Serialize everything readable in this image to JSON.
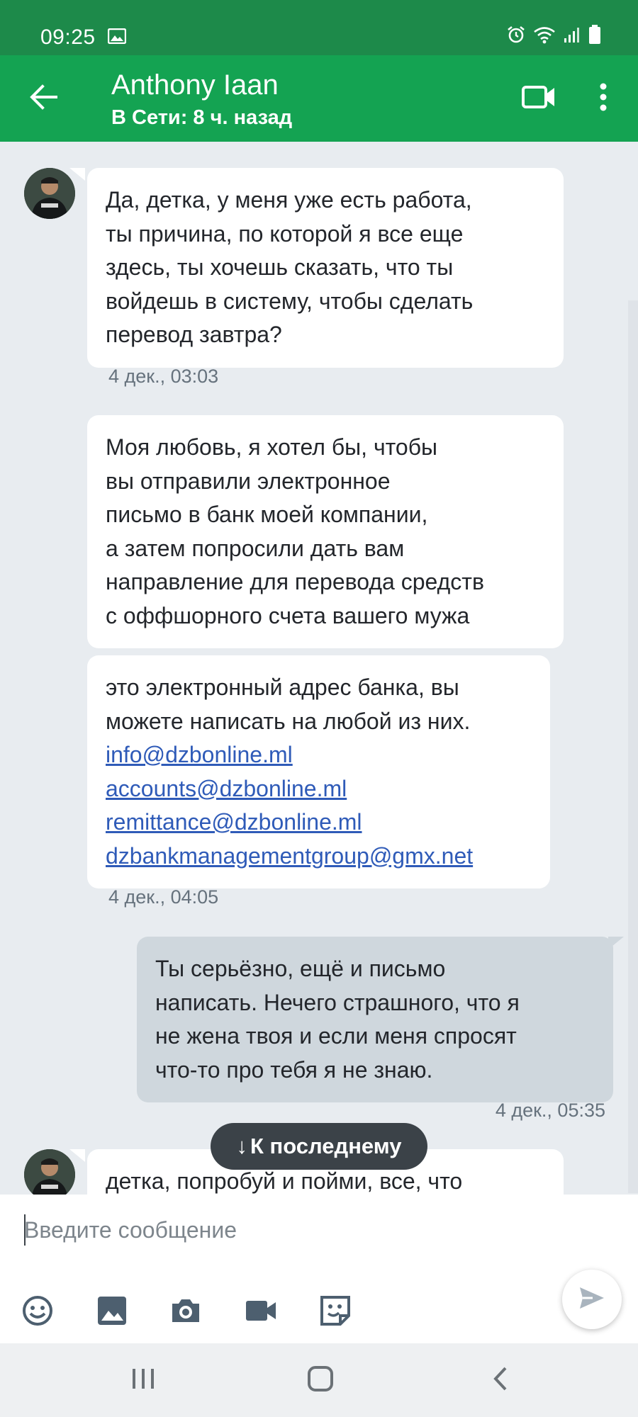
{
  "status_bar": {
    "time": "09:25"
  },
  "header": {
    "contact_name": "Anthony Iaan",
    "contact_status": "В Сети: 8 ч. назад"
  },
  "messages": [
    {
      "direction": "incoming",
      "lines": [
        "Да, детка, у меня уже есть работа,",
        "ты причина, по которой я все еще",
        "здесь, ты хочешь сказать, что ты",
        "войдешь в систему, чтобы сделать",
        "перевод завтра?"
      ],
      "time": "4 дек., 03:03"
    },
    {
      "direction": "incoming",
      "lines": [
        "Моя любовь, я хотел бы, чтобы",
        "вы отправили электронное",
        "письмо в банк моей компании,",
        "а затем попросили дать вам",
        "направление для перевода средств",
        "с оффшорного счета вашего мужа"
      ]
    },
    {
      "direction": "incoming",
      "lines": [
        "это электронный адрес банка, вы",
        "можете написать на любой из них."
      ],
      "links": [
        "info@dzbonline.ml",
        "accounts@dzbonline.ml",
        "remittance@dzbonline.ml",
        "dzbankmanagementgroup@gmx.net"
      ],
      "time": "4 дек., 04:05"
    },
    {
      "direction": "outgoing",
      "lines": [
        "Ты серьёзно,  ещё и письмо",
        "написать. Нечего страшного,  что я",
        "не жена твоя и если меня спросят",
        "что-то про тебя я не знаю."
      ],
      "time": "4 дек., 05:35"
    },
    {
      "direction": "incoming",
      "lines": [
        "детка, попробуй и пойми, все, что"
      ]
    }
  ],
  "jump_to_latest": {
    "arrow": "↓",
    "label": "К последнему"
  },
  "composer": {
    "placeholder": "Введите сообщение"
  },
  "icons": {
    "back": "arrow-left-icon",
    "video": "video-call-icon",
    "more": "more-vert-icon",
    "emoji": "emoji-icon",
    "image": "image-icon",
    "camera": "camera-icon",
    "video_record": "videocam-icon",
    "sticker": "sticker-icon",
    "send": "send-icon"
  },
  "colors": {
    "status_bar": "#1d8a4a",
    "app_bar": "#14a352",
    "chat_background": "#e8ecf0",
    "incoming_bubble": "#ffffff",
    "outgoing_bubble": "#cfd7dd",
    "link": "#2f5bb8"
  }
}
